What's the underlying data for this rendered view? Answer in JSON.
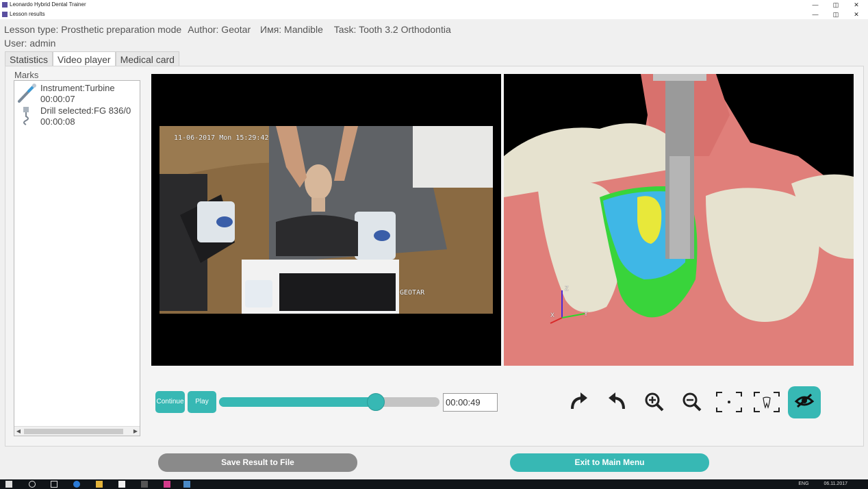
{
  "windows": [
    {
      "title": "Leonardo Hybrid Dental Trainer",
      "controls": [
        "—",
        "◫",
        "✕"
      ]
    },
    {
      "title": "Lesson results",
      "controls": [
        "—",
        "◫",
        "✕"
      ]
    }
  ],
  "info": {
    "lesson_type": "Lesson type: Prosthetic preparation mode",
    "author": "Author: Geotar",
    "name": "Имя: Mandible",
    "task": "Task: Tooth 3.2 Orthodontia",
    "user": "User: admin"
  },
  "tabs": [
    {
      "label": "Statistics"
    },
    {
      "label": "Video player"
    },
    {
      "label": "Medical card"
    }
  ],
  "marks": {
    "label": "Marks",
    "items": [
      {
        "title": "Instrument:Turbine",
        "time": "00:00:07",
        "icon": "turbine-icon"
      },
      {
        "title": "Drill selected:FG 836/0",
        "time": "00:00:08",
        "icon": "drill-icon"
      }
    ]
  },
  "video": {
    "timestamp_overlay": "11-06-2017 Mon 15:29:42",
    "watermark": "GEOTAR"
  },
  "axes_gizmo": {
    "x": "X",
    "y": "Y",
    "z": "Z"
  },
  "player": {
    "continue_label": "Continue",
    "play_label": "Play",
    "progress": 0.71,
    "time": "00:00:49"
  },
  "toolbar": {
    "icons": [
      "redo-icon",
      "undo-icon",
      "zoom-in-icon",
      "zoom-out-icon",
      "fit-view-icon",
      "tooth-focus-icon",
      "visibility-toggle-icon"
    ]
  },
  "actions": {
    "save_label": "Save Result to File",
    "exit_label": "Exit to Main Menu"
  },
  "taskbar": {
    "lang": "ENG",
    "date": "06.11.2017"
  },
  "colors": {
    "accent": "#37b8b4",
    "save_button": "#8a8a8a",
    "gum": "#e07f7a",
    "tooth": "#e6e2cf",
    "prep_blue": "#3fb7e6",
    "prep_green": "#39d43b",
    "prep_yellow": "#e8e83a"
  }
}
